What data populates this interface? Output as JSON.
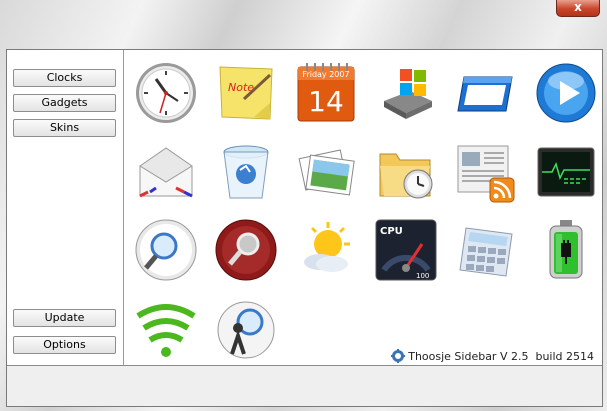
{
  "window": {
    "close_label": "x"
  },
  "sidebar": {
    "clocks_label": "Clocks",
    "gadgets_label": "Gadgets",
    "skins_label": "Skins",
    "update_label": "Update",
    "options_label": "Options"
  },
  "calendar": {
    "header": "Friday 2007",
    "day": "14"
  },
  "note": {
    "text": "Note"
  },
  "cpu": {
    "label": "CPU",
    "value": "100"
  },
  "footer": {
    "version_text": "Thoosje Sidebar V 2.5  build 2514"
  },
  "colors": {
    "accent_red": "#c9452b",
    "calendar_orange": "#e05a10",
    "battery_green": "#2fbf2f"
  }
}
